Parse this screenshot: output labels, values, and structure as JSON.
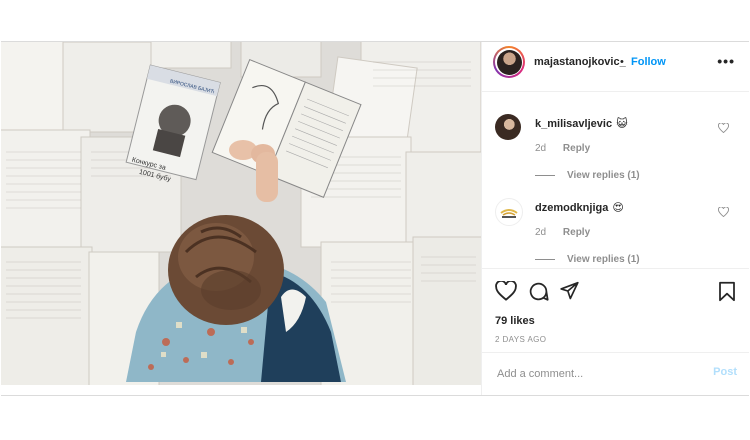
{
  "header": {
    "username": "majastanojkovic_",
    "separator": "•",
    "follow_label": "Follow",
    "more_label": "•••"
  },
  "comments": [
    {
      "username": "k_milisavljevic",
      "emoji": "😺",
      "time": "2d",
      "reply_label": "Reply",
      "view_replies": "View replies (1)"
    },
    {
      "username": "dzemodknjiga",
      "emoji": "😍",
      "time": "2d",
      "reply_label": "Reply",
      "view_replies": "View replies (1)"
    }
  ],
  "actions": {
    "likes": "79 likes",
    "time_ago": "2 DAYS AGO",
    "comment_placeholder": "Add a comment...",
    "post_label": "Post"
  },
  "photo": {
    "book_title_line1": "Конкурс за",
    "book_title_line2": "1001 бубу",
    "book_author": "ВИРОСЛАВ БАЈИЋ"
  },
  "icons": {
    "like": "heart-icon",
    "comment": "comment-icon",
    "share": "share-icon",
    "save": "bookmark-icon"
  },
  "colors": {
    "follow": "#0095f6",
    "post_disabled": "#b2dffc",
    "muted": "#8e8e8e"
  }
}
